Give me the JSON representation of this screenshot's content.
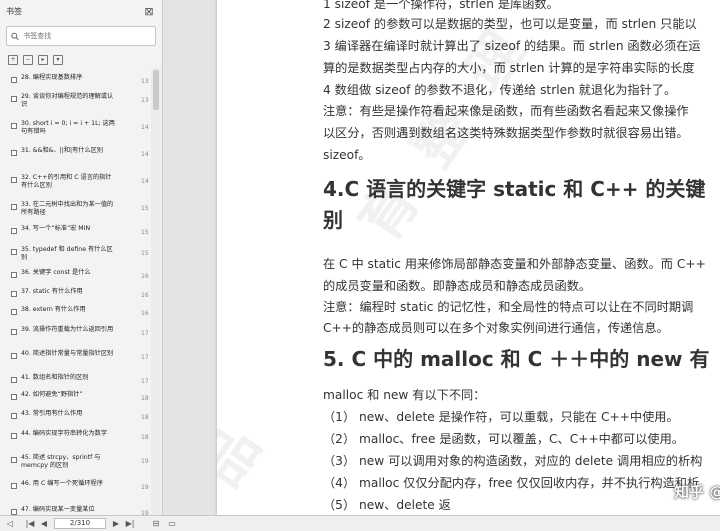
{
  "sidebar": {
    "title": "书签",
    "search_placeholder": "书签查找",
    "items": [
      {
        "label": "28. 编程实现基数排序",
        "page": "13"
      },
      {
        "label": "29. 谈谈你对编程规范的理解或认识",
        "page": "13"
      },
      {
        "label": "30. short i = 0; i = i + 1L; 这两句有错吗",
        "page": "14"
      },
      {
        "label": "31. &&和&、||和|有什么区别",
        "page": "14"
      },
      {
        "label": "32. C++的引用和 C 语言的指针有什么区别",
        "page": "14"
      },
      {
        "label": "33. 在二元树中找出和为某一值的所有路径",
        "page": "15"
      },
      {
        "label": "34. 写一个“标准”宏 MIN",
        "page": "15"
      },
      {
        "label": "35. typedef 和 define 有什么区别",
        "page": "15"
      },
      {
        "label": "36. 关键字 const 是什么",
        "page": "16"
      },
      {
        "label": "37. static 有什么作用",
        "page": "16"
      },
      {
        "label": "38. extern 有什么作用",
        "page": "16"
      },
      {
        "label": "39. 流操作符重载为什么返回引用",
        "page": "17"
      },
      {
        "label": "40. 简述指针常量与常量指针区别",
        "page": "17"
      },
      {
        "label": "41. 数组名和指针的区别",
        "page": "17"
      },
      {
        "label": "42. 如何避免“野指针”",
        "page": "18"
      },
      {
        "label": "43. 常引用有什么作用",
        "page": "18"
      },
      {
        "label": "44. 编码实现字符串转化为数字",
        "page": "18"
      },
      {
        "label": "45. 简述 strcpy、sprintf 与 memcpy 的区别",
        "page": "19"
      },
      {
        "label": "46. 用 C 编写一个死循环程序",
        "page": "19"
      },
      {
        "label": "47. 编码实现某一变量某位",
        "page": "19"
      }
    ]
  },
  "navigation": {
    "page_display": "2/310"
  },
  "document": {
    "lines_top": [
      "1 sizeof 是一个操作符，strlen 是库函数。",
      "2 sizeof 的参数可以是数据的类型，也可以是变量，而 strlen 只能以",
      "3 编译器在编译时就计算出了 sizeof 的结果。而 strlen 函数必须在运",
      "算的是数据类型占内存的大小，而 strlen 计算的是字符串实际的长度",
      "4 数组做 sizeof 的参数不退化，传递给 strlen 就退化为指针了。",
      "注意：有些是操作符看起来像是函数，而有些函数名看起来又像操作",
      "以区分，否则遇到数组名这类特殊数据类型作参数时就很容易出错。",
      "sizeof。"
    ],
    "heading4_line1": "4.C 语言的关键字 static 和 C++ 的关键",
    "heading4_line2": "别",
    "lines_mid": [
      "在 C 中 static 用来修饰局部静态变量和外部静态变量、函数。而 C++",
      "的成员变量和函数。即静态成员和静态成员函数。",
      "注意：编程时 static 的记忆性，和全局性的特点可以让在不同时期调",
      "C++的静态成员则可以在多个对象实例间进行通信，传递信息。"
    ],
    "heading5": "5. C 中的 malloc 和 C ＋＋中的 new 有",
    "lines_bottom": [
      "malloc 和 new 有以下不同：",
      "（1） new、delete 是操作符，可以重载，只能在 C++中使用。",
      "（2） malloc、free 是函数，可以覆盖，C、C++中都可以使用。",
      "（3） new 可以调用对象的构造函数，对应的 delete 调用相应的析构",
      "（4） malloc 仅仅分配内存，free 仅仅回收内存，并不执行构造和析",
      "（5） new、delete 返"
    ],
    "zhihu_watermark": "知乎 @零声Github整理库"
  }
}
